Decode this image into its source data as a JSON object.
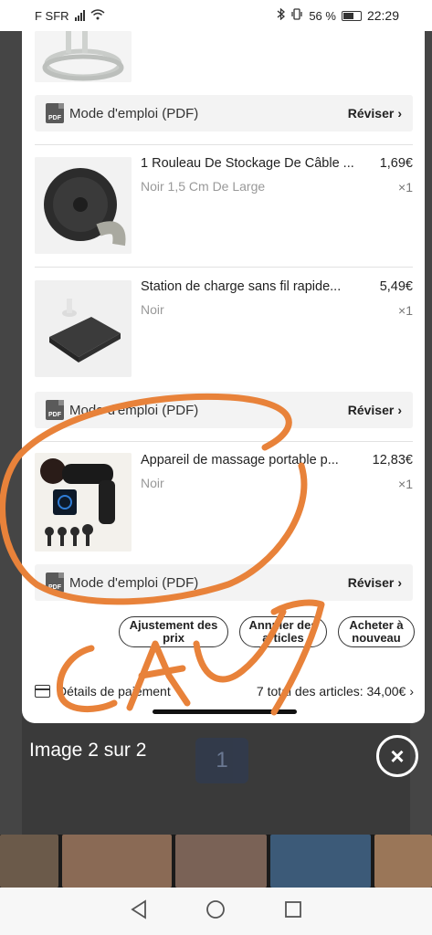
{
  "status_bar": {
    "carrier": "F SFR",
    "battery": "56 %",
    "time": "22:29"
  },
  "viewer": {
    "pdf_rows": [
      {
        "label": "Mode d'emploi (PDF)",
        "action": "Réviser"
      },
      {
        "label": "Mode d'emploi (PDF)",
        "action": "Réviser"
      },
      {
        "label": "Mode d'emploi (PDF)",
        "action": "Réviser"
      }
    ],
    "pdf_badge": "PDF",
    "items": [
      {
        "title": "1 Rouleau De Stockage De Câble ...",
        "variant": "Noir 1,5 Cm De Large",
        "price": "1,69€",
        "qty": "×1"
      },
      {
        "title": "Station de charge sans fil rapide...",
        "variant": "Noir",
        "price": "5,49€",
        "qty": "×1"
      },
      {
        "title": "Appareil de massage portable p...",
        "variant": "Noir",
        "price": "12,83€",
        "qty": "×1"
      }
    ],
    "actions": {
      "adjust": "Ajustement des prix",
      "cancel": "Annuler des articles",
      "rebuy": "Acheter à nouveau"
    },
    "payment": {
      "label": "Détails de paiement",
      "total": "7 total des articles: 34,00€"
    }
  },
  "caption": "Image 2 sur 2",
  "pager": "1",
  "annotation_text": "CAY",
  "colors": {
    "scribble": "#e8823a",
    "viewer_bg": "#ffffff",
    "backdrop": "#2a2a2a"
  }
}
